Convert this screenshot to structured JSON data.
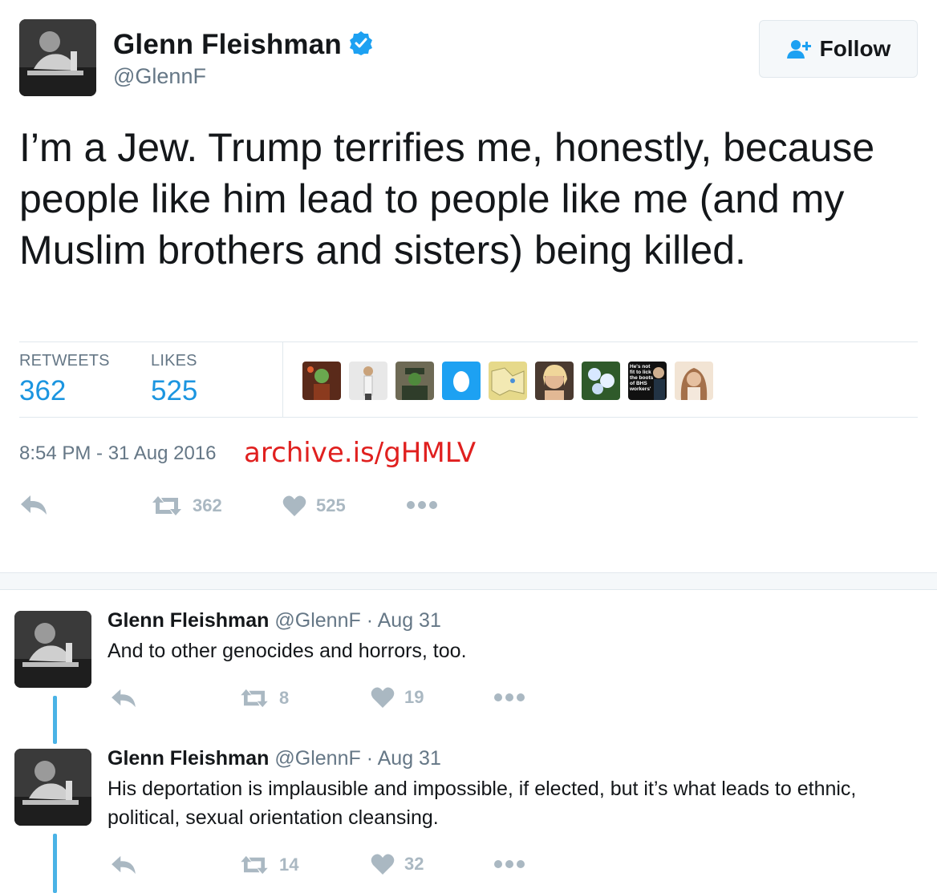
{
  "main_tweet": {
    "author_name": "Glenn Fleishman",
    "handle": "@GlennF",
    "follow_label": "Follow",
    "text": "I’m a Jew. Trump terrifies me, honestly, because people like him lead to people like me (and my Muslim brothers and sisters) being killed.",
    "retweets_label": "RETWEETS",
    "retweets_count": "362",
    "likes_label": "LIKES",
    "likes_count": "525",
    "likers_avatars": [
      {
        "icon": "liker-avatar-green-figure"
      },
      {
        "icon": "liker-avatar-woman"
      },
      {
        "icon": "liker-avatar-uniform"
      },
      {
        "icon": "liker-avatar-egg"
      },
      {
        "icon": "liker-avatar-map"
      },
      {
        "icon": "liker-avatar-blonde"
      },
      {
        "icon": "liker-avatar-flowers"
      },
      {
        "icon": "liker-avatar-newspaper",
        "text_lines": [
          "He's not",
          "fit to lick",
          "the boots",
          "of BHS",
          "workers"
        ]
      },
      {
        "icon": "liker-avatar-woman-2"
      }
    ],
    "timestamp": "8:54 PM - 31 Aug 2016",
    "archive_link": "archive.is/gHMLV",
    "action_retweets": "362",
    "action_likes": "525"
  },
  "replies": [
    {
      "author_name": "Glenn Fleishman",
      "handle": "@GlennF",
      "date": "· Aug 31",
      "text": "And to other genocides and horrors, too.",
      "retweets": "8",
      "likes": "19"
    },
    {
      "author_name": "Glenn Fleishman",
      "handle": "@GlennF",
      "date": "· Aug 31",
      "text": "His deportation is implausible and impossible, if elected, but it’s what leads to ethnic, political, sexual orientation cleansing.",
      "retweets": "14",
      "likes": "32"
    }
  ],
  "colors": {
    "link_blue": "#1b95e0",
    "muted_gray": "#657786",
    "icon_gray": "#aab8c2",
    "archive_red": "#e0201f",
    "thread_blue": "#4ab3e6"
  }
}
